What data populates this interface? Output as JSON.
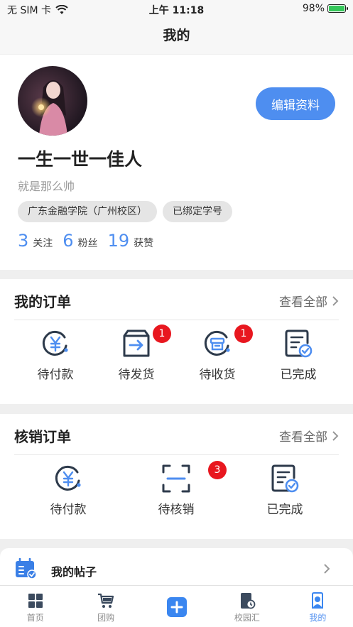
{
  "status_bar": {
    "carrier": "无 SIM 卡",
    "time": "上午 11:18",
    "battery": "98%",
    "battery_level": 0.98
  },
  "nav": {
    "title": "我的"
  },
  "profile": {
    "edit_label": "编辑资料",
    "username": "一生一世一佳人",
    "bio": "就是那么帅",
    "tags": [
      "广东金融学院（广州校区）",
      "已绑定学号"
    ],
    "stats": [
      {
        "num": "3",
        "label": "关注"
      },
      {
        "num": "6",
        "label": "粉丝"
      },
      {
        "num": "19",
        "label": "获赞"
      }
    ]
  },
  "orders": {
    "title": "我的订单",
    "view_all": "查看全部",
    "items": [
      {
        "label": "待付款",
        "icon": "yuan-icon",
        "badge": ""
      },
      {
        "label": "待发货",
        "icon": "box-arrow-icon",
        "badge": "1"
      },
      {
        "label": "待收货",
        "icon": "receive-icon",
        "badge": "1"
      },
      {
        "label": "已完成",
        "icon": "check-doc-icon",
        "badge": ""
      }
    ]
  },
  "verify": {
    "title": "核销订单",
    "view_all": "查看全部",
    "items": [
      {
        "label": "待付款",
        "icon": "yuan-icon",
        "badge": ""
      },
      {
        "label": "待核销",
        "icon": "scan-icon",
        "badge": "3"
      },
      {
        "label": "已完成",
        "icon": "check-doc-icon",
        "badge": ""
      }
    ]
  },
  "posts": {
    "title": "我的帖子"
  },
  "tabbar": [
    {
      "label": "首页",
      "icon": "home-grid-icon"
    },
    {
      "label": "团购",
      "icon": "cart-icon"
    },
    {
      "label": "",
      "icon": "plus-icon"
    },
    {
      "label": "校园汇",
      "icon": "book-icon"
    },
    {
      "label": "我的",
      "icon": "profile-icon",
      "active": true
    }
  ],
  "colors": {
    "accent": "#4e8ef0",
    "icon_dark": "#2d3a4b",
    "badge": "#e8171f"
  }
}
